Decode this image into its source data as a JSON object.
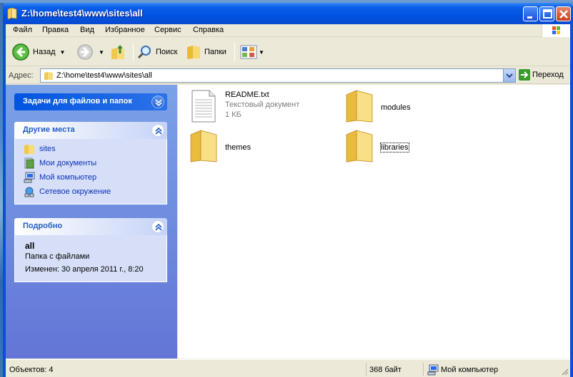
{
  "window": {
    "title": "Z:\\home\\test4\\www\\sites\\all",
    "accent": "#0a4fd6"
  },
  "menu": {
    "items": [
      "Файл",
      "Правка",
      "Вид",
      "Избранное",
      "Сервис",
      "Справка"
    ]
  },
  "toolbar": {
    "back_label": "Назад",
    "search_label": "Поиск",
    "folders_label": "Папки",
    "icons": [
      "back-icon",
      "forward-icon",
      "up-folder-icon",
      "search-icon",
      "folders-icon",
      "views-icon"
    ]
  },
  "address": {
    "label": "Адрес:",
    "value": "Z:\\home\\test4\\www\\sites\\all",
    "go_label": "Переход"
  },
  "taskpane": {
    "tasks_title": "Задачи для файлов и папок",
    "places_title": "Другие места",
    "places": [
      {
        "label": "sites",
        "icon": "folder-icon"
      },
      {
        "label": "Мои документы",
        "icon": "my-documents-icon"
      },
      {
        "label": "Мой компьютер",
        "icon": "my-computer-icon"
      },
      {
        "label": "Сетевое окружение",
        "icon": "network-icon"
      }
    ],
    "details_title": "Подробно",
    "details": {
      "name": "all",
      "type": "Папка с файлами",
      "modified": "Изменен: 30 апреля 2011 г., 8:20"
    }
  },
  "files": [
    {
      "name": "README.txt",
      "type": "Текстовый документ",
      "size": "1 КБ",
      "icon": "text-file-icon"
    },
    {
      "name": "modules",
      "icon": "folder-icon"
    },
    {
      "name": "themes",
      "icon": "folder-icon"
    },
    {
      "name": "libraries",
      "icon": "folder-icon"
    }
  ],
  "status": {
    "objects": "Объектов: 4",
    "size": "368 байт",
    "location": "Мой компьютер"
  }
}
